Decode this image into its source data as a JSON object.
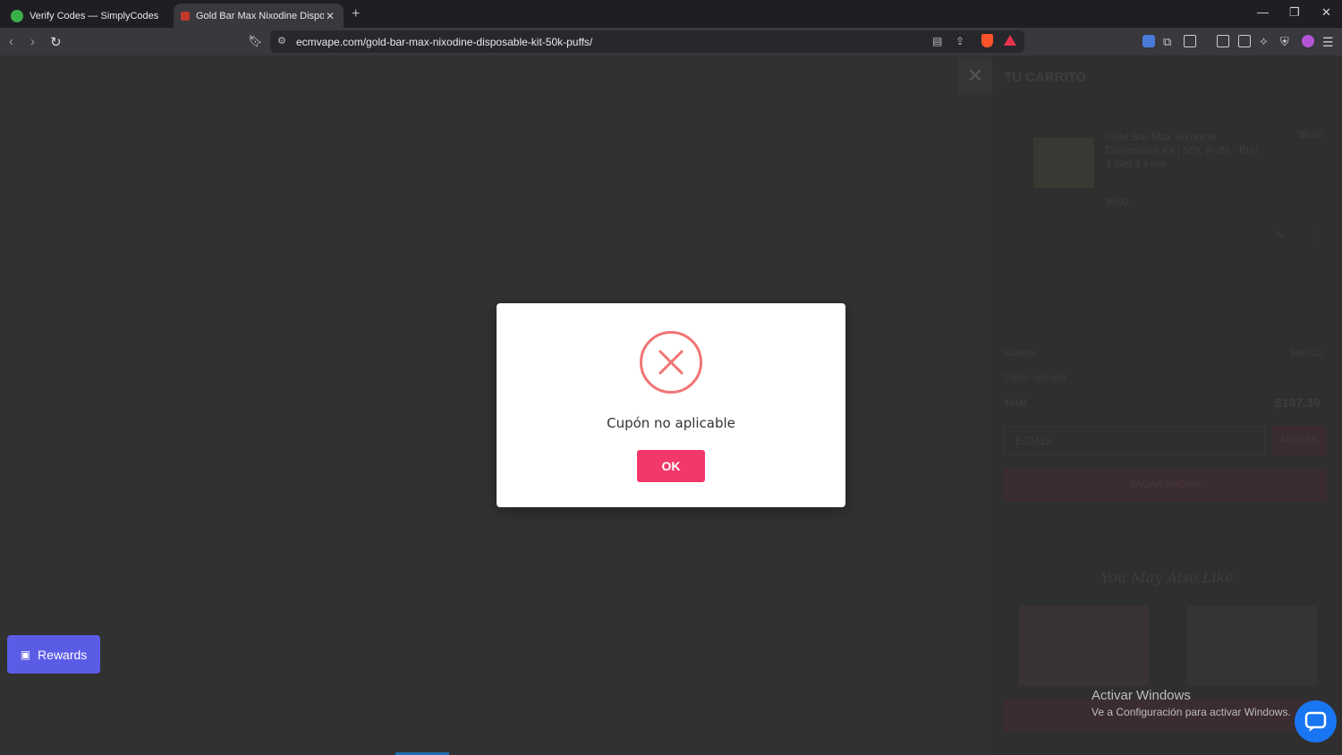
{
  "browser": {
    "tabs": [
      {
        "title": "Verify Codes — SimplyCodes",
        "active": false
      },
      {
        "title": "Gold Bar Max Nixodine Disposab",
        "active": true
      }
    ],
    "url": "ecmvape.com/gold-bar-max-nixodine-disposable-kit-50k-puffs/"
  },
  "cart": {
    "heading": "TU CARRITO",
    "item_title": "Gold Bar Max Nixodine Disposable Kit | 50K Puffs - Buy 1 Get 1 Free",
    "item_price": "$0.00",
    "item_unit": "$0.00",
    "subtotal_label": "Subtotal",
    "subtotal_value": "$969.32",
    "coupon_label": "Cupón aplicado",
    "total_label": "Total",
    "total_value": "$187.39",
    "coupon_input": "ECM15",
    "apply_label": "APLICAR",
    "pay_label": "PAGAR AHORA",
    "recommend_title": "You May Also Like"
  },
  "rewards": {
    "label": "Rewards"
  },
  "modal": {
    "message": "Cupón no aplicable",
    "ok_label": "OK"
  },
  "watermark": {
    "line1": "Activar Windows",
    "line2": "Ve a Configuración para activar Windows."
  },
  "colors": {
    "accent": "#f2386a",
    "error": "#f27474",
    "rewards": "#5b5ce6"
  }
}
